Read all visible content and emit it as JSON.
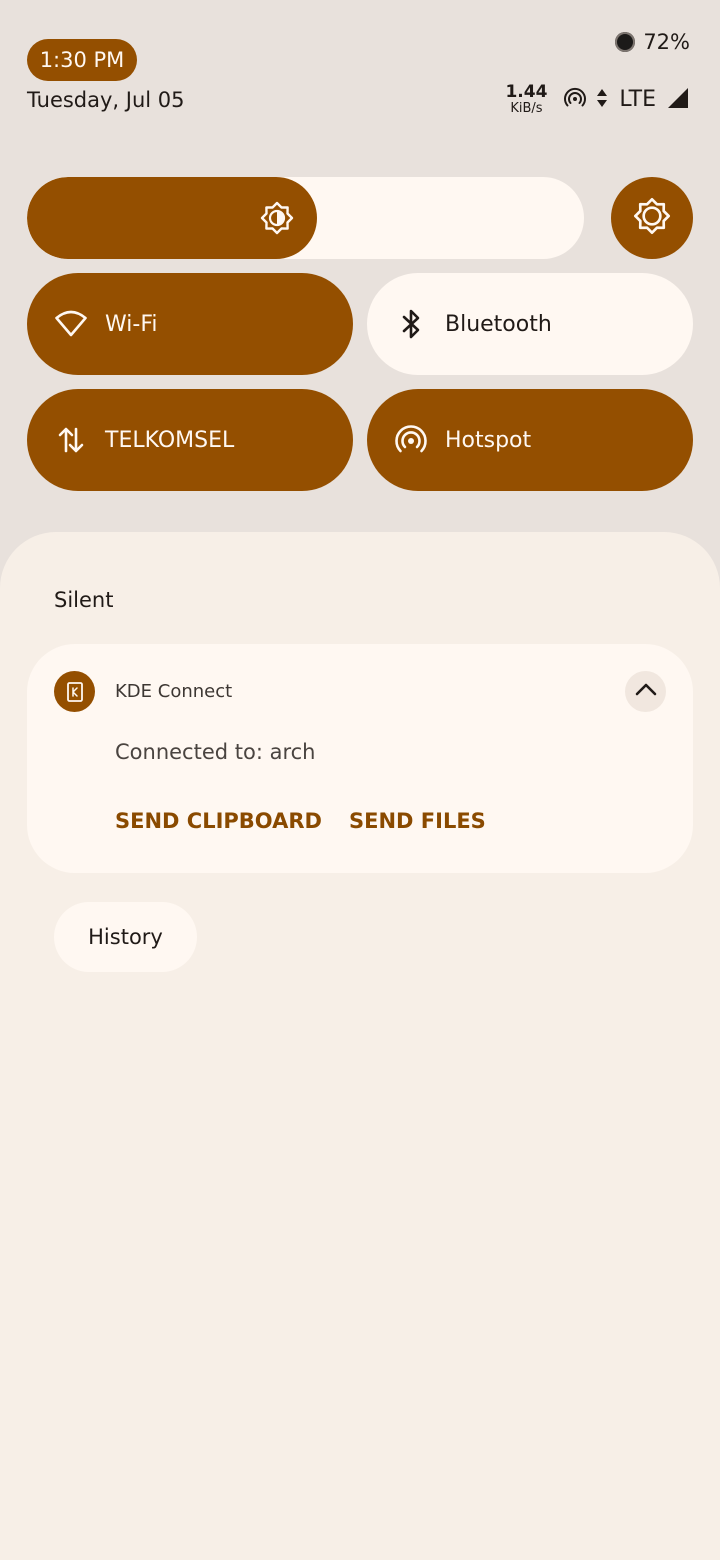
{
  "status_bar": {
    "time": "1:30 PM",
    "date": "Tuesday, Jul 05",
    "battery_percent": "72%",
    "net_speed_value": "1.44",
    "net_speed_unit": "KiB/s",
    "network_type": "LTE",
    "icons": [
      "battery-icon",
      "hotspot-icon",
      "data-activity-icon",
      "signal-icon"
    ]
  },
  "quick_settings": {
    "brightness_level": 0.52,
    "tiles": [
      {
        "label": "Wi-Fi",
        "icon": "wifi-icon",
        "state": "on"
      },
      {
        "label": "Bluetooth",
        "icon": "bluetooth-icon",
        "state": "off"
      },
      {
        "label": "TELKOMSEL",
        "icon": "mobile-data-icon",
        "state": "on"
      },
      {
        "label": "Hotspot",
        "icon": "hotspot-icon",
        "state": "on"
      }
    ]
  },
  "notifications": {
    "section_label": "Silent",
    "items": [
      {
        "app_name": "KDE Connect",
        "text": "Connected to: arch",
        "actions": [
          "SEND CLIPBOARD",
          "SEND FILES"
        ],
        "icon": "kde-connect-icon"
      }
    ],
    "history_label": "History"
  },
  "colors": {
    "accent": "#944f00",
    "surface": "#fff8f2",
    "background": "#e8e1dc",
    "shade": "#f7efe7"
  }
}
